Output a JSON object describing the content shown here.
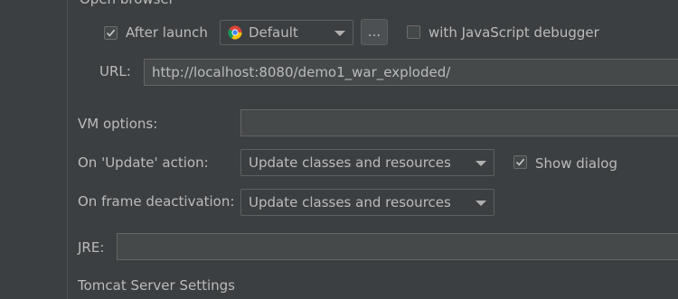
{
  "section_title": "Open browser",
  "after_launch": {
    "checked": true,
    "label": "After launch"
  },
  "browser": {
    "selected": "Default",
    "icon": "chrome-icon"
  },
  "more_button_label": "...",
  "js_debugger": {
    "checked": false,
    "label": "with JavaScript debugger"
  },
  "url": {
    "label": "URL:",
    "value": "http://localhost:8080/demo1_war_exploded/"
  },
  "vm_options": {
    "label": "VM options:",
    "value": ""
  },
  "on_update": {
    "label": "On 'Update' action:",
    "selected": "Update classes and resources"
  },
  "show_dialog": {
    "checked": true,
    "label": "Show dialog"
  },
  "on_frame_deactivation": {
    "label": "On frame deactivation:",
    "selected": "Update classes and resources"
  },
  "jre": {
    "label": "JRE:",
    "value": ""
  },
  "tomcat_settings_title": "Tomcat Server Settings",
  "colors": {
    "background": "#3c3f41",
    "text": "#bbbbbb",
    "field_bg": "#45494a",
    "border": "#5e6060"
  }
}
